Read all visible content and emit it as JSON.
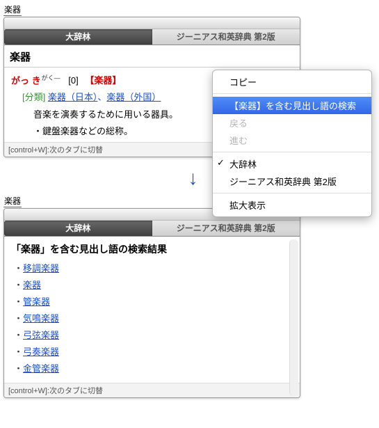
{
  "top_label": "楽器",
  "tabs": {
    "active": "大辞林",
    "inactive": "ジーニアス和英辞典 第2版"
  },
  "header_word": "楽器",
  "reading": {
    "main": "がっ き",
    "ruby": "がく―",
    "idx": "[0]",
    "kanji": "【楽器】"
  },
  "classification": {
    "label": "[分類]",
    "link1": "楽器（日本）",
    "sep": "、",
    "link2": "楽器（外国）"
  },
  "def1": "音楽を演奏するために用いる器具。",
  "def2": "・鍵盤楽器などの総称。",
  "hint": "[control+W]:次のタブに切替",
  "menu": {
    "copy": "コピー",
    "search": "【楽器】を含む見出し語の検索",
    "back": "戻る",
    "forward": "進む",
    "dict1": "大辞林",
    "dict2": "ジーニアス和英辞典 第2版",
    "zoom": "拡大表示"
  },
  "arrow": "↓",
  "result": {
    "title": "「楽器」を含む見出し語の検索結果",
    "items": [
      "移調楽器",
      "楽器",
      "管楽器",
      "気鳴楽器",
      "弓弦楽器",
      "弓奏楽器",
      "金管楽器"
    ]
  }
}
